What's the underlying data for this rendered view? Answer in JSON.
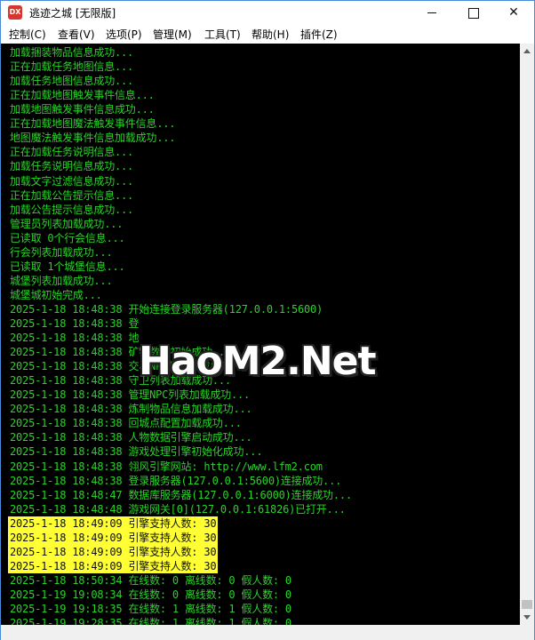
{
  "window": {
    "icon_text": "DX",
    "title": "逃迹之城 [无限版]",
    "controls": {
      "minimize": "",
      "maximize": "",
      "close": "✕"
    }
  },
  "menu": [
    "控制(C)",
    "查看(V)",
    "选项(P)",
    "管理(M)",
    "工具(T)",
    "帮助(H)",
    "插件(Z)"
  ],
  "watermark": "HaoM2.Net",
  "log": [
    {
      "text": "加载捆装物品信息成功...",
      "highlight": false
    },
    {
      "text": "正在加载任务地图信息...",
      "highlight": false
    },
    {
      "text": "加载任务地图信息成功...",
      "highlight": false
    },
    {
      "text": "正在加载地图触发事件信息...",
      "highlight": false
    },
    {
      "text": "加载地图触发事件信息成功...",
      "highlight": false
    },
    {
      "text": "正在加载地图魔法触发事件信息...",
      "highlight": false
    },
    {
      "text": "地图魔法触发事件信息加载成功...",
      "highlight": false
    },
    {
      "text": "正在加载任务说明信息...",
      "highlight": false
    },
    {
      "text": "加载任务说明信息成功...",
      "highlight": false
    },
    {
      "text": "加载文字过滤信息成功...",
      "highlight": false
    },
    {
      "text": "正在加载公告提示信息...",
      "highlight": false
    },
    {
      "text": "加载公告提示信息成功...",
      "highlight": false
    },
    {
      "text": "管理员列表加载成功...",
      "highlight": false
    },
    {
      "text": "已读取 0个行会信息...",
      "highlight": false
    },
    {
      "text": "行会列表加载成功...",
      "highlight": false
    },
    {
      "text": "已读取 1个城堡信息...",
      "highlight": false
    },
    {
      "text": "城堡列表加载成功...",
      "highlight": false
    },
    {
      "text": "城堡城初始完成...",
      "highlight": false
    },
    {
      "text": "2025-1-18 18:48:38 开始连接登录服务器(127.0.0.1:5600)",
      "highlight": false
    },
    {
      "text": "2025-1-18 18:48:38 登",
      "highlight": false
    },
    {
      "text": "2025-1-18 18:48:38 地",
      "highlight": false
    },
    {
      "text": "2025-1-18 18:48:38 矿物数据初始成功...",
      "highlight": false
    },
    {
      "text": "2025-1-18 18:48:38 交易NPC列表加载成功...",
      "highlight": false
    },
    {
      "text": "2025-1-18 18:48:38 守卫列表加载成功...",
      "highlight": false
    },
    {
      "text": "2025-1-18 18:48:38 管理NPC列表加载成功...",
      "highlight": false
    },
    {
      "text": "2025-1-18 18:48:38 炼制物品信息加载成功...",
      "highlight": false
    },
    {
      "text": "2025-1-18 18:48:38 回城点配置加载成功...",
      "highlight": false
    },
    {
      "text": "2025-1-18 18:48:38 人物数据引擎启动成功...",
      "highlight": false
    },
    {
      "text": "2025-1-18 18:48:38 游戏处理引擎初始化成功...",
      "highlight": false
    },
    {
      "text": "2025-1-18 18:48:38 翎风引擎网站: http://www.lfm2.com",
      "highlight": false
    },
    {
      "text": "2025-1-18 18:48:38 登录服务器(127.0.0.1:5600)连接成功...",
      "highlight": false
    },
    {
      "text": "2025-1-18 18:48:47 数据库服务器(127.0.0.1:6000)连接成功...",
      "highlight": false
    },
    {
      "text": "2025-1-18 18:48:48 游戏网关[0](127.0.0.1:61826)已打开...",
      "highlight": false
    },
    {
      "text": "2025-1-18 18:49:09 引擎支持人数: 30",
      "highlight": true
    },
    {
      "text": "2025-1-18 18:49:09 引擎支持人数: 30",
      "highlight": true
    },
    {
      "text": "2025-1-18 18:49:09 引擎支持人数: 30",
      "highlight": true
    },
    {
      "text": "2025-1-18 18:49:09 引擎支持人数: 30",
      "highlight": true
    },
    {
      "text": "2025-1-18 18:50:34 在线数: 0 离线数: 0 假人数: 0",
      "highlight": false
    },
    {
      "text": "2025-1-19 19:08:34 在线数: 0 离线数: 0 假人数: 0",
      "highlight": false
    },
    {
      "text": "2025-1-19 19:18:35 在线数: 1 离线数: 1 假人数: 0",
      "highlight": false
    },
    {
      "text": "2025-1-19 19:28:35 在线数: 1 离线数: 1 假人数: 0",
      "highlight": false
    }
  ],
  "colors": {
    "console_bg": "#000000",
    "log_text": "#28d428",
    "highlight_bg": "#ffff33",
    "highlight_text": "#111111",
    "app_icon": "#d6362b"
  }
}
